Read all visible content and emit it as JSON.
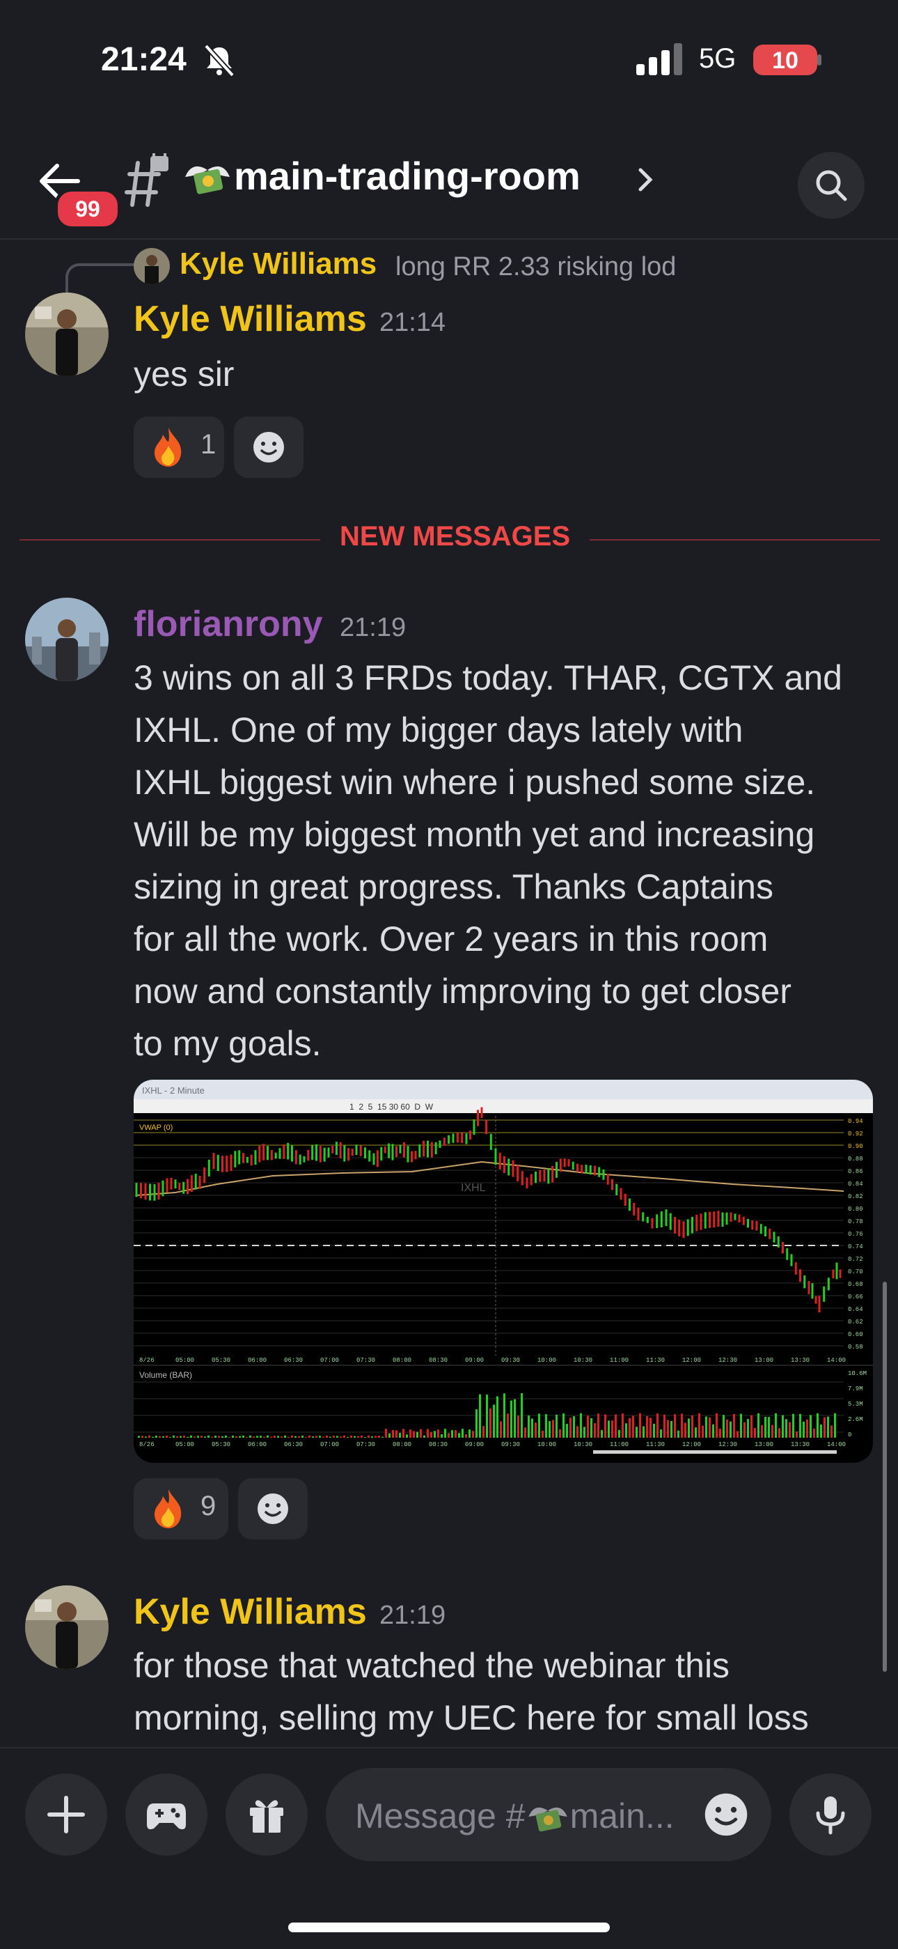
{
  "status_bar": {
    "time": "21:24",
    "network": "5G",
    "battery": "10"
  },
  "header": {
    "unread_badge": "99",
    "channel_name": "main-trading-room"
  },
  "messages": {
    "reply_preview": {
      "author": "Kyle Williams",
      "text": "long RR 2.33 risking lod"
    },
    "m1": {
      "author": "Kyle Williams",
      "author_color": "#f0c419",
      "timestamp": "21:14",
      "text": "yes sir",
      "reaction": {
        "emoji": "fire-icon",
        "count": "1"
      }
    },
    "new_messages_label": "NEW MESSAGES",
    "m2": {
      "author": "florianrony",
      "author_color": "#9b59b6",
      "timestamp": "21:19",
      "lines": [
        "3 wins on all 3 FRDs today. THAR, CGTX and",
        "IXHL. One of my bigger days lately with",
        "IXHL biggest win where i pushed some size.",
        "Will be my biggest month yet and increasing",
        "sizing in great progress. Thanks Captains",
        "for all the work. Over 2 years in this room",
        "now and constantly improving to get closer",
        "to my goals."
      ],
      "attachment": {
        "window_title": "IXHL - 2 Minute",
        "toolbar_intervals": "1  2  5  15 30 60  D  W",
        "vwap_label": "VWAP (0)",
        "watermark": "IXHL",
        "volume_label": "Volume (BAR)",
        "time_ticks": [
          "8/26",
          "05:00",
          "05:30",
          "06:00",
          "06:30",
          "07:00",
          "07:30",
          "08:00",
          "08:30",
          "09:00",
          "09:30",
          "10:00",
          "10:30",
          "11:00",
          "11:30",
          "12:00",
          "12:30",
          "13:00",
          "13:30",
          "14:00"
        ],
        "price_ticks": [
          "0.94",
          "0.92",
          "0.90",
          "0.88",
          "0.86",
          "0.84",
          "0.82",
          "0.80",
          "0.78",
          "0.76",
          "0.74",
          "0.72",
          "0.70",
          "0.68",
          "0.66",
          "0.64",
          "0.62",
          "0.60",
          "0.58"
        ],
        "volume_ticks": [
          "10.6M",
          "7.9M",
          "5.3M",
          "2.6M",
          "0"
        ]
      },
      "reaction": {
        "emoji": "fire-icon",
        "count": "9"
      }
    },
    "m3": {
      "author": "Kyle Williams",
      "author_color": "#f0c419",
      "timestamp": "21:19",
      "lines": [
        "for those that watched the webinar this",
        "morning, selling my UEC here for small loss"
      ]
    }
  },
  "composer": {
    "placeholder_prefix": "Message #",
    "placeholder_suffix": "main..."
  }
}
